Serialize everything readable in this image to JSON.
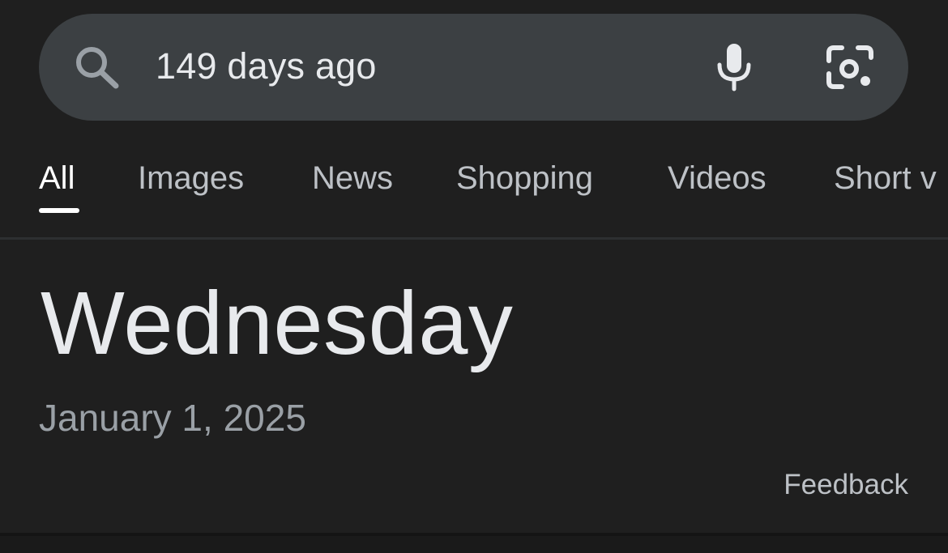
{
  "search": {
    "query": "149 days ago"
  },
  "icons": {
    "search": "search-icon",
    "voice": "microphone-icon",
    "lens": "camera-lens-icon"
  },
  "tabs": [
    {
      "label": "All",
      "active": true
    },
    {
      "label": "Images",
      "active": false
    },
    {
      "label": "News",
      "active": false
    },
    {
      "label": "Shopping",
      "active": false
    },
    {
      "label": "Videos",
      "active": false
    },
    {
      "label": "Short v",
      "active": false
    }
  ],
  "result": {
    "day": "Wednesday",
    "date": "January 1, 2025",
    "feedback_label": "Feedback"
  },
  "colors": {
    "background": "#1f1f1f",
    "search_bar": "#3c4043",
    "primary_text": "#e8eaed",
    "secondary_text": "#9aa0a6",
    "tab_text": "#bdc1c6",
    "active_tab": "#ffffff"
  }
}
